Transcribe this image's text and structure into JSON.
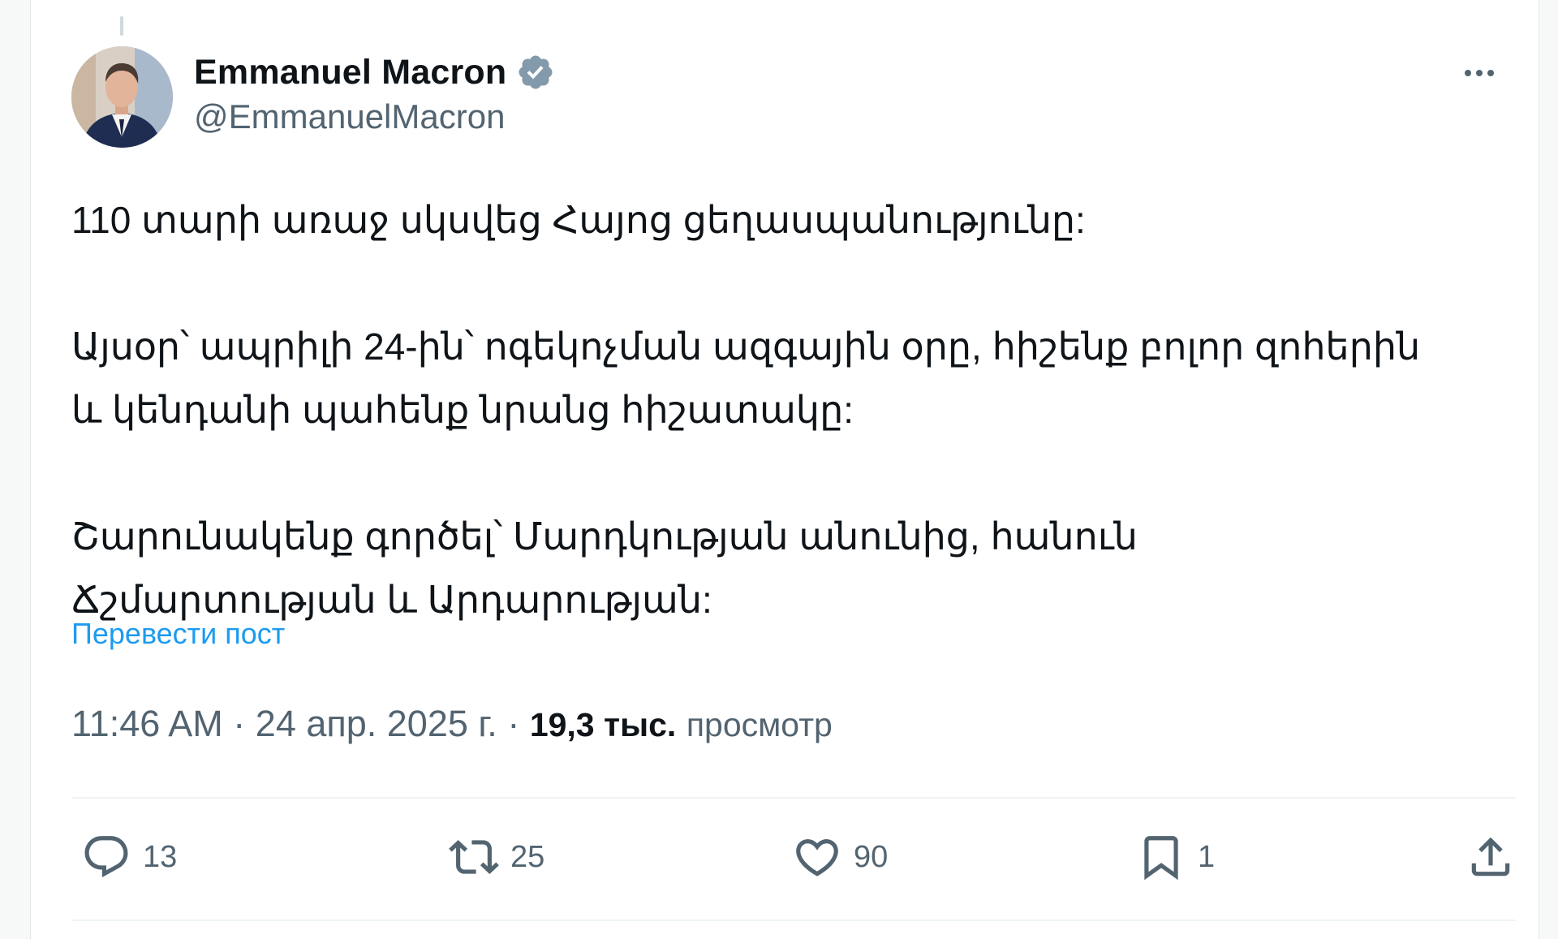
{
  "author": {
    "name": "Emmanuel Macron",
    "handle": "@EmmanuelMacron",
    "verified": true,
    "verified_color": "#829aab"
  },
  "post": {
    "paragraphs": [
      [
        "110 տարի առաջ սկսվեց Հայոց ցեղասպանությունը:"
      ],
      [
        "Այսօր՝ ապրիլի 24-ին՝ ոգեկոչման ազգային օրը, հիշենք բոլոր զոհերին",
        "և կենդանի պահենք նրանց հիշատակը:"
      ],
      [
        "Շարունակենք գործել՝ Մարդկության անունից, հանուն",
        "Ճշմարտության և Արդարության:"
      ]
    ],
    "translate_link": "Перевести пост"
  },
  "meta": {
    "time": "11:46 AM",
    "separator": " · ",
    "date": "24 апр. 2025 г.",
    "views_count": "19,3 тыс.",
    "views_label": "просмотр"
  },
  "actions": {
    "replies": {
      "icon": "reply-icon",
      "count": "13"
    },
    "reposts": {
      "icon": "repost-icon",
      "count": "25"
    },
    "likes": {
      "icon": "heart-icon",
      "count": "90"
    },
    "bookmarks": {
      "icon": "bookmark-icon",
      "count": "1"
    },
    "share": {
      "icon": "share-icon"
    }
  },
  "colors": {
    "text_primary": "#0f1419",
    "text_secondary": "#536471",
    "link": "#1d9bf0"
  }
}
